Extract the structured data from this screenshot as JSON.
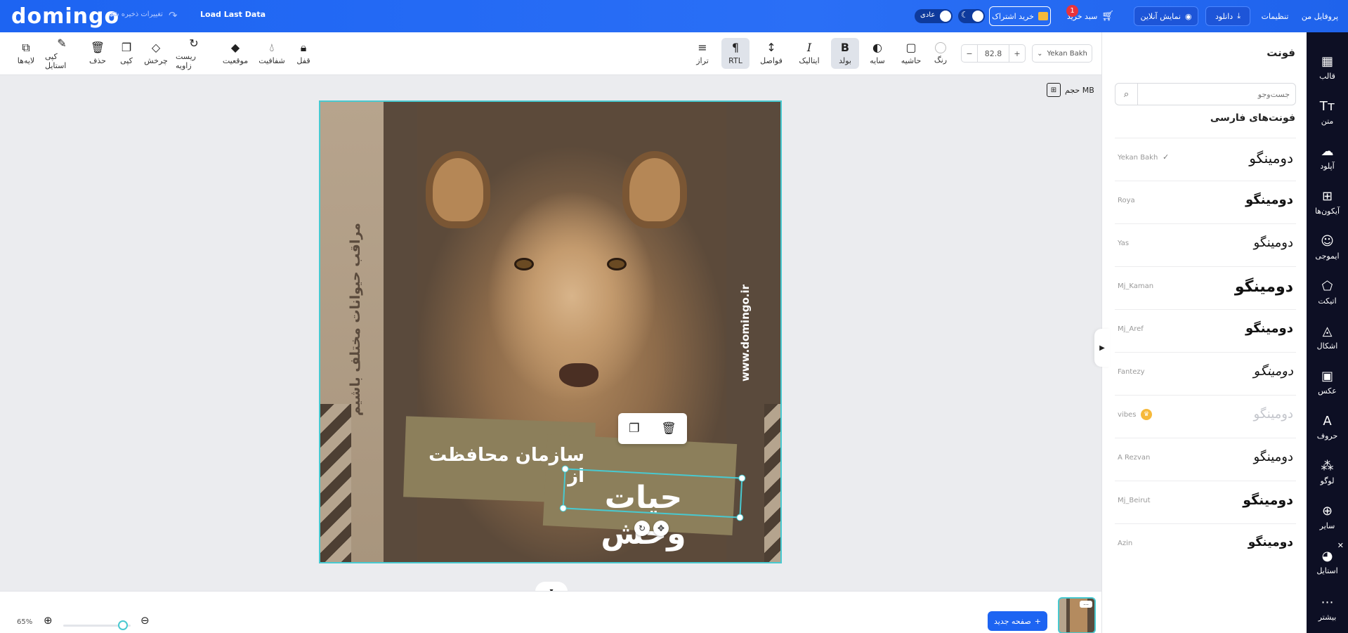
{
  "topbar": {
    "logo": "domingo",
    "saved_text": "تغییرات ذخیره شد",
    "load_last": "Load Last Data",
    "mode_label": "عادی",
    "subscribe_label": "خرید اشتراک",
    "cart_label": "سبد خرید",
    "cart_badge": "1",
    "preview_label": "نمایش آنلاین",
    "download_label": "دانلود",
    "settings_label": "تنظیمات",
    "profile_label": "پروفایل من"
  },
  "toolbar": {
    "font": "Yekan Bakh",
    "font_size": "82.8",
    "tools": [
      {
        "label": "رنگ"
      },
      {
        "label": "حاشیه"
      },
      {
        "label": "سایه"
      },
      {
        "label": "بولد"
      },
      {
        "label": "ایتالیک"
      },
      {
        "label": "فواصل"
      },
      {
        "label": "RTL"
      },
      {
        "label": "تراز"
      }
    ],
    "actions": [
      {
        "label": "قفل"
      },
      {
        "label": "شفافیت"
      },
      {
        "label": "موقعیت"
      },
      {
        "label": "ریست زاویه"
      },
      {
        "label": "چرخش"
      },
      {
        "label": "کپی"
      },
      {
        "label": "حذف"
      },
      {
        "label": "کپی استایل"
      },
      {
        "label": "لایه‌ها"
      }
    ]
  },
  "canvas": {
    "size_label": "حجم MB",
    "left_vertical_text": "مراقب حیوانات مختلف باشیم",
    "right_vertical_text": "www.domingo.ir",
    "banner_line1": "سازمان محافظت از",
    "banner_line2": "حیات وحش"
  },
  "font_panel": {
    "title": "فونت",
    "search_placeholder": "جست‌وجو",
    "section_title": "فونت‌های فارسی",
    "sample_text": "دومینگو",
    "fonts": [
      {
        "name": "Yekan Bakh",
        "selected": true
      },
      {
        "name": "Roya"
      },
      {
        "name": "Yas"
      },
      {
        "name": "Mj_Kaman"
      },
      {
        "name": "Mj_Aref"
      },
      {
        "name": "Fantezy"
      },
      {
        "name": "vibes",
        "pro": true
      },
      {
        "name": "A Rezvan"
      },
      {
        "name": "Mj_Beirut"
      },
      {
        "name": "Azin"
      }
    ]
  },
  "right_nav": [
    {
      "label": "قالب",
      "icon": "template-icon"
    },
    {
      "label": "متن",
      "icon": "text-icon"
    },
    {
      "label": "آپلود",
      "icon": "upload-icon"
    },
    {
      "label": "آیکون‌ها",
      "icon": "icons-icon"
    },
    {
      "label": "ایموجی",
      "icon": "emoji-icon"
    },
    {
      "label": "اتیکت",
      "icon": "sticker-icon"
    },
    {
      "label": "اشکال",
      "icon": "shapes-icon"
    },
    {
      "label": "عکس",
      "icon": "photo-icon"
    },
    {
      "label": "حروف",
      "icon": "letters-icon"
    },
    {
      "label": "لوگو",
      "icon": "logo-icon"
    },
    {
      "label": "سایر",
      "icon": "other-icon"
    },
    {
      "label": "استایل",
      "icon": "style-icon"
    },
    {
      "label": "بیشتر",
      "icon": "more-icon"
    }
  ],
  "bottom": {
    "zoom": "65%",
    "new_page_label": "صفحه جدید"
  }
}
